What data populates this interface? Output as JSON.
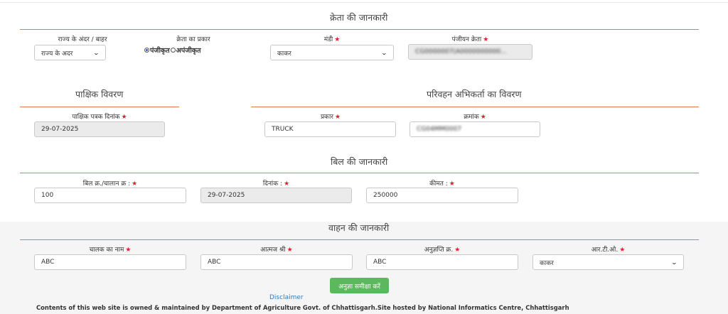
{
  "buyer": {
    "title": "क्रेता की जानकारी",
    "state_label": "राज्य के अंदर / बाहर",
    "state_value": "राज्य के अदर",
    "buyer_type_label": "क्रेता का प्रकार",
    "radio_registered": "पंजीकृत",
    "radio_unregistered": "अपंजीकृत",
    "mandi_label": "मंडी",
    "mandi_value": "काकर",
    "registered_buyer_label": "पंजीयन क्रेता",
    "registered_buyer_value": "CG0000007(A0000000000..."
  },
  "fortnight": {
    "title": "पाक्षिक विवरण",
    "date_label": "पाक्षिक पत्रक दिनांक",
    "date_value": "29-07-2025"
  },
  "transport": {
    "title": "परिवहन अभिकर्ता का विवरण",
    "type_label": "प्रकार",
    "type_value": "TRUCK",
    "number_label": "क्रमांक",
    "number_value": "CG04MM0007"
  },
  "bill": {
    "title": "बिल की जानकारी",
    "bill_no_label": "बिल क्र./चालान क्र :",
    "bill_no_value": "100",
    "date_label": "दिनांक :",
    "date_value": "29-07-2025",
    "price_label": "कीमत :",
    "price_value": "250000"
  },
  "vehicle": {
    "title": "वाहन की जानकारी",
    "driver_label": "चालक का नाम",
    "driver_value": "ABC",
    "relative_label": "आत्मज श्री",
    "relative_value": "ABC",
    "license_label": "अनुज्ञप्ति क्र.",
    "license_value": "ABC",
    "rto_label": "आर.टी.ओ.",
    "rto_value": "काकर"
  },
  "actions": {
    "review_button": "अनुज्ञा समीक्षा करें"
  },
  "footer": {
    "disclaimer": "Disclaimer",
    "text": "Contents of this web site is owned & maintained by Department of Agriculture Govt. of Chhattisgarh.Site hosted by National Informatics Centre, Chhattisgarh"
  },
  "colors": {
    "divider": "#e07b53",
    "required_star": "#d9232d",
    "button": "#5cb85c",
    "link": "#337ab7",
    "readonly_bg": "#ebebeb",
    "lower_bg": "#f5f5f5"
  }
}
